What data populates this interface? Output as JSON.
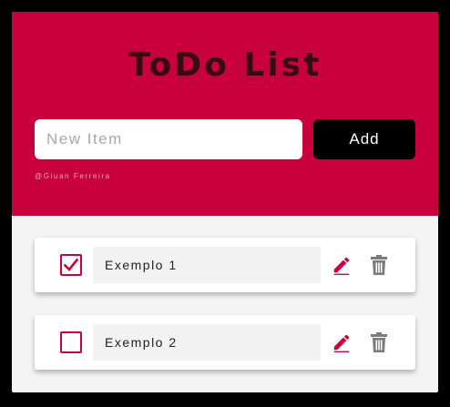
{
  "header": {
    "title": "ToDo List",
    "input_placeholder": "New Item",
    "input_value": "",
    "add_label": "Add",
    "credit": "@Giuan Ferreira"
  },
  "items": [
    {
      "text": "Exemplo 1",
      "checked": true
    },
    {
      "text": "Exemplo 2",
      "checked": false
    }
  ],
  "colors": {
    "accent": "#c8003c",
    "title": "#3a0a14",
    "button": "#000000",
    "trash": "#7a7a7a"
  },
  "icons": {
    "check": "check-icon",
    "edit": "pencil-edit-icon",
    "delete": "trash-icon"
  }
}
